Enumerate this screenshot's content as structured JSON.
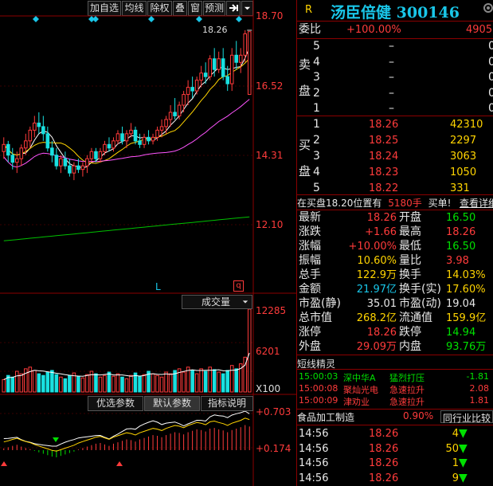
{
  "toolbar": {
    "items": [
      "加自选",
      "均线",
      "除权",
      "叠",
      "窗",
      "预测"
    ],
    "menu_icon": "pin-icon",
    "dropdown_icon": "chevron-down-icon"
  },
  "main_chart": {
    "y_ticks": [
      "18.70",
      "16.52",
      "14.31",
      "12.10"
    ],
    "high_marker": "18.26",
    "l_marker": "L",
    "q_marker": "q",
    "volume_label": "成交量",
    "volume_ticks": [
      "12285",
      "6201",
      "X100"
    ],
    "indicator_tabs": [
      "优选参数",
      "默认参数",
      "指标说明"
    ],
    "indicator_ticks": [
      "+0.703",
      "+0.174"
    ]
  },
  "chart_data": {
    "type": "candlestick",
    "y_range": [
      11.0,
      18.7
    ],
    "candles": [
      [
        14.9,
        15.3,
        14.7,
        15.1
      ],
      [
        15.1,
        15.2,
        14.6,
        14.8
      ],
      [
        14.8,
        15.0,
        14.4,
        14.6
      ],
      [
        14.6,
        14.9,
        14.3,
        14.7
      ],
      [
        14.7,
        15.1,
        14.5,
        15.0
      ],
      [
        15.0,
        15.4,
        14.8,
        15.2
      ],
      [
        15.2,
        15.6,
        15.0,
        15.5
      ],
      [
        15.5,
        15.9,
        15.3,
        15.7
      ],
      [
        15.7,
        16.0,
        15.4,
        15.6
      ],
      [
        15.6,
        15.9,
        15.2,
        15.4
      ],
      [
        15.4,
        15.6,
        14.9,
        15.0
      ],
      [
        15.0,
        15.2,
        14.6,
        14.8
      ],
      [
        14.8,
        15.0,
        14.4,
        14.5
      ],
      [
        14.5,
        14.8,
        14.3,
        14.7
      ],
      [
        14.7,
        14.9,
        14.4,
        14.5
      ],
      [
        14.5,
        14.7,
        14.2,
        14.3
      ],
      [
        14.3,
        14.6,
        14.1,
        14.5
      ],
      [
        14.5,
        14.7,
        14.3,
        14.4
      ],
      [
        14.4,
        14.6,
        14.2,
        14.5
      ],
      [
        14.5,
        14.8,
        14.3,
        14.7
      ],
      [
        14.7,
        15.0,
        14.6,
        14.9
      ],
      [
        14.9,
        15.0,
        14.6,
        14.7
      ],
      [
        14.7,
        15.0,
        14.6,
        14.9
      ],
      [
        14.9,
        15.2,
        14.8,
        15.1
      ],
      [
        15.1,
        15.3,
        14.9,
        15.0
      ],
      [
        15.0,
        15.3,
        14.9,
        15.2
      ],
      [
        15.2,
        15.5,
        15.1,
        15.4
      ],
      [
        15.4,
        15.6,
        15.1,
        15.2
      ],
      [
        15.2,
        15.5,
        15.0,
        15.4
      ],
      [
        15.4,
        15.7,
        15.3,
        15.5
      ],
      [
        15.5,
        15.6,
        15.1,
        15.2
      ],
      [
        15.2,
        15.4,
        15.0,
        15.1
      ],
      [
        15.1,
        15.4,
        15.0,
        15.3
      ],
      [
        15.3,
        15.5,
        15.1,
        15.2
      ],
      [
        15.2,
        15.4,
        15.1,
        15.3
      ],
      [
        15.3,
        15.6,
        15.2,
        15.5
      ],
      [
        15.5,
        15.8,
        15.3,
        15.6
      ],
      [
        15.6,
        15.9,
        15.4,
        15.8
      ],
      [
        15.8,
        16.2,
        15.6,
        16.0
      ],
      [
        16.0,
        16.4,
        15.8,
        15.9
      ],
      [
        15.9,
        16.3,
        15.8,
        16.2
      ],
      [
        16.2,
        16.6,
        16.0,
        16.5
      ],
      [
        16.5,
        16.9,
        16.2,
        16.7
      ],
      [
        16.7,
        17.0,
        16.4,
        16.6
      ],
      [
        16.6,
        17.0,
        16.5,
        16.9
      ],
      [
        16.9,
        17.3,
        16.7,
        17.1
      ],
      [
        17.1,
        17.4,
        16.8,
        17.0
      ],
      [
        17.0,
        17.6,
        16.9,
        17.5
      ],
      [
        17.5,
        17.8,
        17.0,
        17.2
      ],
      [
        17.2,
        17.7,
        17.1,
        17.5
      ],
      [
        17.5,
        17.8,
        16.9,
        17.0
      ],
      [
        17.0,
        17.3,
        16.6,
        16.8
      ],
      [
        16.8,
        17.8,
        16.6,
        17.6
      ],
      [
        17.6,
        18.0,
        17.2,
        17.4
      ],
      [
        17.4,
        17.8,
        17.1,
        17.6
      ],
      [
        17.6,
        18.3,
        17.4,
        18.2
      ],
      [
        16.5,
        18.26,
        16.5,
        18.26
      ]
    ],
    "volume": [
      0.15,
      0.2,
      0.18,
      0.25,
      0.22,
      0.28,
      0.3,
      0.26,
      0.22,
      0.2,
      0.24,
      0.26,
      0.21,
      0.18,
      0.16,
      0.2,
      0.23,
      0.19,
      0.17,
      0.21,
      0.25,
      0.22,
      0.18,
      0.2,
      0.24,
      0.19,
      0.22,
      0.18,
      0.16,
      0.2,
      0.23,
      0.19,
      0.21,
      0.25,
      0.22,
      0.2,
      0.18,
      0.24,
      0.22,
      0.26,
      0.28,
      0.24,
      0.3,
      0.26,
      0.22,
      0.28,
      0.25,
      0.3,
      0.27,
      0.24,
      0.22,
      0.26,
      0.32,
      0.28,
      0.34,
      0.42,
      1.0
    ],
    "macd_hist": [
      0.05,
      0.08,
      0.12,
      0.15,
      0.1,
      0.06,
      0.03,
      -0.02,
      -0.06,
      -0.1,
      -0.14,
      -0.18,
      -0.2,
      -0.16,
      -0.12,
      -0.08,
      -0.04,
      0.02,
      0.06,
      0.1,
      0.14,
      0.18,
      0.2,
      0.16,
      0.12,
      0.18,
      0.22,
      0.26,
      0.3,
      0.28,
      0.24,
      0.3,
      0.34,
      0.38,
      0.42,
      0.4,
      0.36,
      0.42,
      0.46,
      0.5,
      0.48,
      0.44,
      0.5,
      0.54,
      0.58,
      0.56,
      0.52,
      0.6,
      0.62,
      0.58,
      0.55,
      0.5,
      0.56,
      0.6,
      0.64,
      0.7,
      0.66
    ]
  },
  "quote": {
    "r_label": "R",
    "name": "汤臣倍健",
    "code": "300146",
    "weibi_label": "委比",
    "weibi_val": "+100.00%",
    "weibi_diff": "4905",
    "sell_label": [
      "卖",
      "盘"
    ],
    "sell": [
      {
        "lv": "5",
        "p": "–",
        "v": "0"
      },
      {
        "lv": "4",
        "p": "–",
        "v": "0"
      },
      {
        "lv": "3",
        "p": "–",
        "v": "0"
      },
      {
        "lv": "2",
        "p": "–",
        "v": "0"
      },
      {
        "lv": "1",
        "p": "–",
        "v": "0"
      }
    ],
    "buy_label": [
      "买",
      "盘"
    ],
    "buy": [
      {
        "lv": "1",
        "p": "18.26",
        "v": "42310"
      },
      {
        "lv": "2",
        "p": "18.25",
        "v": "2297"
      },
      {
        "lv": "3",
        "p": "18.24",
        "v": "3063"
      },
      {
        "lv": "4",
        "p": "18.23",
        "v": "1050"
      },
      {
        "lv": "5",
        "p": "18.22",
        "v": "331"
      }
    ],
    "tip_text": "在买盘18.20位置有",
    "tip_qty": "5180手",
    "tip_act": "买单!",
    "tip_link": "查看详细",
    "stats": [
      {
        "l": "最新",
        "v": "18.26",
        "vc": "red",
        "l2": "开盘",
        "v2": "16.50",
        "v2c": "grn"
      },
      {
        "l": "涨跌",
        "v": "+1.66",
        "vc": "red",
        "l2": "最高",
        "v2": "18.26",
        "v2c": "red"
      },
      {
        "l": "涨幅",
        "v": "+10.00%",
        "vc": "red",
        "l2": "最低",
        "v2": "16.50",
        "v2c": "grn"
      },
      {
        "l": "振幅",
        "v": "10.60%",
        "vc": "yel",
        "l2": "量比",
        "v2": "3.98",
        "v2c": "red"
      },
      {
        "l": "总手",
        "v": "122.9万",
        "vc": "yel",
        "l2": "换手",
        "v2": "14.03%",
        "v2c": "yel"
      },
      {
        "l": "金额",
        "v": "21.97亿",
        "vc": "cy",
        "l2": "换手(实)",
        "v2": "17.60%",
        "v2c": "yel"
      },
      {
        "l": "市盈(静)",
        "v": "35.01",
        "vc": "wht",
        "l2": "市盈(动)",
        "v2": "19.04",
        "v2c": "wht"
      },
      {
        "l": "总市值",
        "v": "268.2亿",
        "vc": "yel",
        "l2": "流通值",
        "v2": "159.9亿",
        "v2c": "yel"
      },
      {
        "l": "涨停",
        "v": "18.26",
        "vc": "red",
        "l2": "跌停",
        "v2": "14.94",
        "v2c": "grn"
      },
      {
        "l": "外盘",
        "v": "29.09万",
        "vc": "red",
        "l2": "内盘",
        "v2": "93.76万",
        "v2c": "grn"
      }
    ],
    "elf_title": "短线精灵",
    "elf": [
      {
        "t": "15:00:03",
        "n": "深中华A",
        "a": "猛烈打压",
        "v": "-1.81",
        "nc": "grn",
        "ac": "grn",
        "vc": "grn"
      },
      {
        "t": "15:00:08",
        "n": "聚灿光电",
        "a": "急速拉升",
        "v": "2.08",
        "nc": "red",
        "ac": "red",
        "vc": "red"
      },
      {
        "t": "15:00:09",
        "n": "津劝业",
        "a": "急速拉升",
        "v": "1.81",
        "nc": "red",
        "ac": "red",
        "vc": "red"
      }
    ],
    "sector_name": "食品加工制造",
    "sector_pct": "0.90%",
    "sector_btn": "同行业比较",
    "ticks": [
      {
        "t": "14:56",
        "p": "18.26",
        "v": "4"
      },
      {
        "t": "14:56",
        "p": "18.26",
        "v": "50"
      },
      {
        "t": "14:56",
        "p": "18.26",
        "v": "1"
      },
      {
        "t": "14:56",
        "p": "18.26",
        "v": "9"
      }
    ]
  }
}
